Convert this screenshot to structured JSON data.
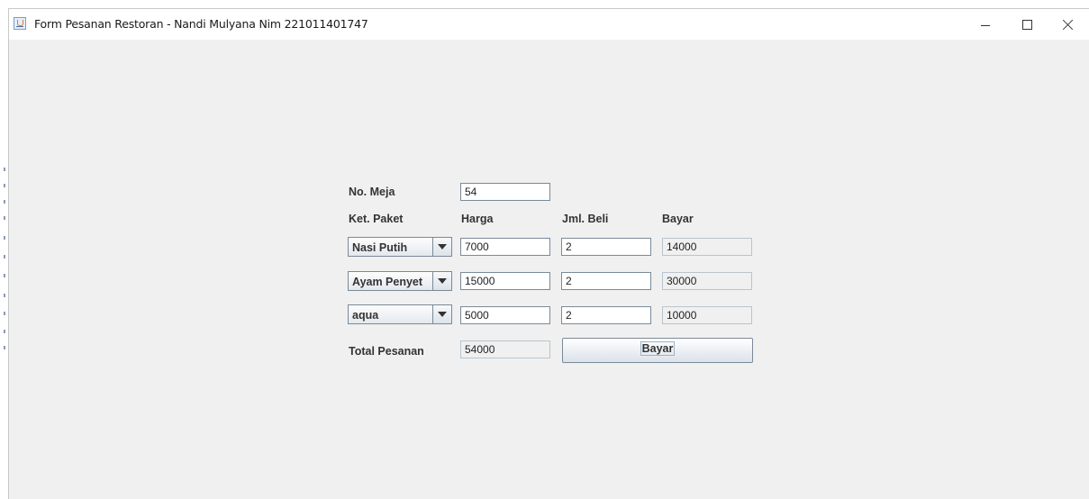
{
  "window": {
    "title": "Form Pesanan Restoran - Nandi Mulyana Nim 221011401747"
  },
  "form": {
    "no_meja_label": "No. Meja",
    "no_meja_value": "54",
    "headers": {
      "paket": "Ket. Paket",
      "harga": "Harga",
      "jml": "Jml. Beli",
      "bayar": "Bayar"
    },
    "rows": [
      {
        "paket": "Nasi Putih",
        "harga": "7000",
        "jml": "2",
        "bayar": "14000"
      },
      {
        "paket": "Ayam Penyet",
        "harga": "15000",
        "jml": "2",
        "bayar": "30000"
      },
      {
        "paket": "aqua",
        "harga": "5000",
        "jml": "2",
        "bayar": "10000"
      }
    ],
    "total_label": "Total Pesanan",
    "total_value": "54000",
    "bayar_button": "Bayar"
  },
  "icons": {
    "app": "java-app-icon",
    "minimize": "minimize-icon",
    "maximize": "maximize-icon",
    "close": "close-icon",
    "dropdown": "chevron-down-icon"
  }
}
